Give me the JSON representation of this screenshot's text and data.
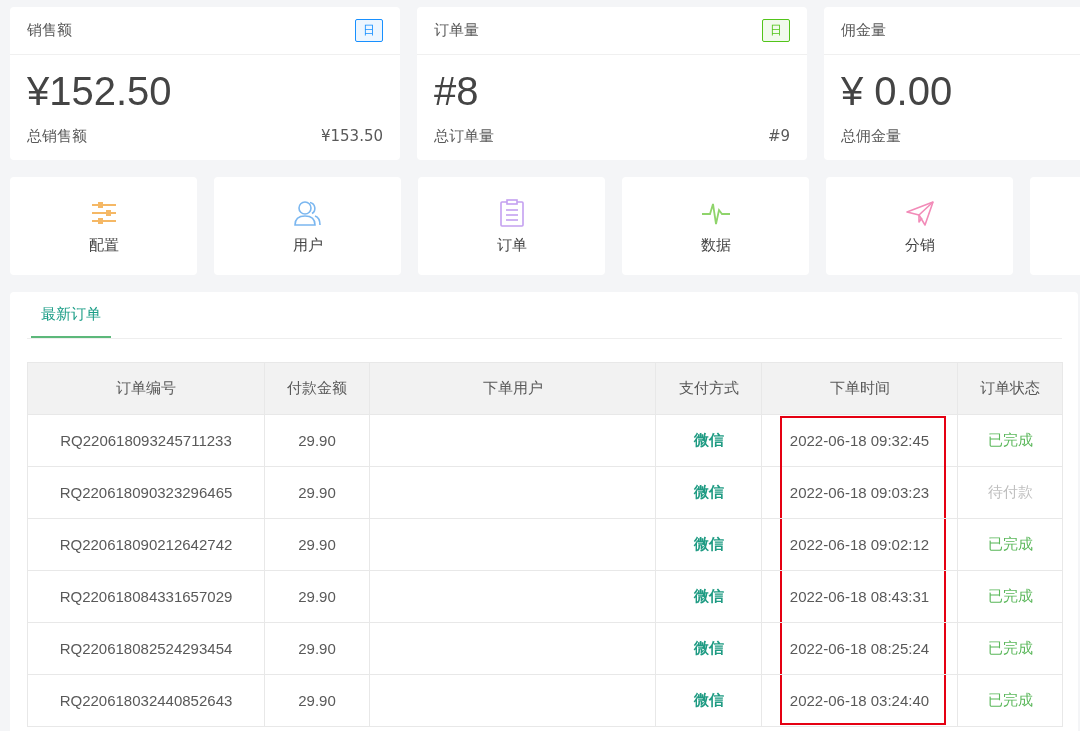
{
  "stats": [
    {
      "title": "销售额",
      "badge": {
        "label": "日",
        "color": "#1890ff"
      },
      "value": "¥152.50",
      "total_label": "总销售额",
      "total": "¥153.50"
    },
    {
      "title": "订单量",
      "badge": {
        "label": "日",
        "color": "#52c41a"
      },
      "value": "#8",
      "total_label": "总订单量",
      "total": "#9"
    },
    {
      "title": "佣金量",
      "value": "¥ 0.00",
      "total_label": "总佣金量"
    }
  ],
  "shortcuts": [
    {
      "label": "配置"
    },
    {
      "label": "用户"
    },
    {
      "label": "订单"
    },
    {
      "label": "数据"
    },
    {
      "label": "分销"
    }
  ],
  "tabs": [
    {
      "label": "最新订单",
      "selected": true
    }
  ],
  "table": {
    "columns": [
      {
        "label": "订单编号",
        "highlighted": false
      },
      {
        "label": "付款金额",
        "highlighted": false
      },
      {
        "label": "下单用户",
        "highlighted": false
      },
      {
        "label": "支付方式",
        "highlighted": false
      },
      {
        "label": "下单时间",
        "highlighted": true
      },
      {
        "label": "订单状态",
        "highlighted": false
      }
    ],
    "rows": [
      {
        "order_no": "RQ220618093245711233",
        "amount": "29.90",
        "payment": "微信",
        "time": "2022-06-18 09:32:45",
        "status": "已完成",
        "kind": "done"
      },
      {
        "order_no": "RQ220618090323296465",
        "amount": "29.90",
        "payment": "微信",
        "time": "2022-06-18 09:03:23",
        "status": "待付款",
        "kind": "pending"
      },
      {
        "order_no": "RQ220618090212642742",
        "amount": "29.90",
        "payment": "微信",
        "time": "2022-06-18 09:02:12",
        "status": "已完成",
        "kind": "done"
      },
      {
        "order_no": "RQ220618084331657029",
        "amount": "29.90",
        "payment": "微信",
        "time": "2022-06-18 08:43:31",
        "status": "已完成",
        "kind": "done"
      },
      {
        "order_no": "RQ220618082524293454",
        "amount": "29.90",
        "payment": "微信",
        "time": "2022-06-18 08:25:24",
        "status": "已完成",
        "kind": "done"
      },
      {
        "order_no": "RQ220618032440852643",
        "amount": "29.90",
        "payment": "微信",
        "time": "2022-06-18 03:24:40",
        "status": "已完成",
        "kind": "done"
      }
    ]
  }
}
